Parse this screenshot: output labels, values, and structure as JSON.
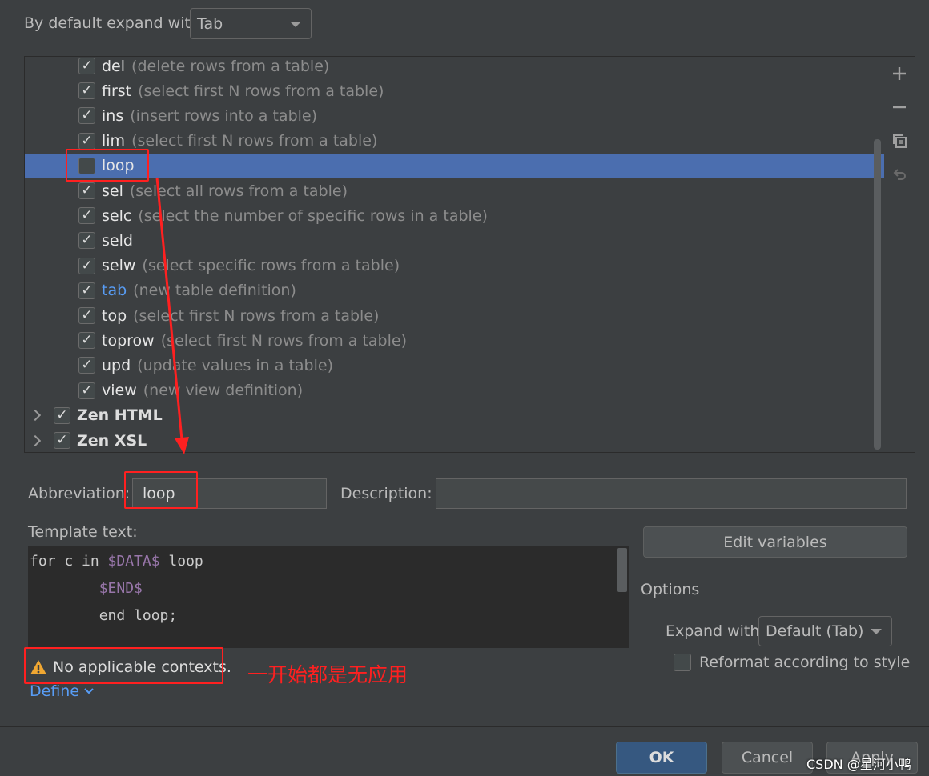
{
  "top": {
    "expand_label": "By default expand with",
    "expand_value": "Tab"
  },
  "tree": {
    "items": [
      {
        "abbr": "del",
        "desc": "(delete rows from a table)",
        "checked": true
      },
      {
        "abbr": "first",
        "desc": "(select first N rows from a table)",
        "checked": true
      },
      {
        "abbr": "ins",
        "desc": "(insert rows into a table)",
        "checked": true
      },
      {
        "abbr": "lim",
        "desc": "(select first N rows from a table)",
        "checked": true
      },
      {
        "abbr": "loop",
        "desc": "",
        "checked": false,
        "selected": true
      },
      {
        "abbr": "sel",
        "desc": "(select all rows from a table)",
        "checked": true
      },
      {
        "abbr": "selc",
        "desc": "(select the number of specific rows in a table)",
        "checked": true
      },
      {
        "abbr": "seld",
        "desc": "",
        "checked": true
      },
      {
        "abbr": "selw",
        "desc": "(select specific rows from a table)",
        "checked": true
      },
      {
        "abbr": "tab",
        "desc": "(new table definition)",
        "checked": true,
        "modified": true
      },
      {
        "abbr": "top",
        "desc": "(select first N rows from a table)",
        "checked": true
      },
      {
        "abbr": "toprow",
        "desc": "(select first N rows from a table)",
        "checked": true
      },
      {
        "abbr": "upd",
        "desc": "(update values in a table)",
        "checked": true
      },
      {
        "abbr": "view",
        "desc": "(new view definition)",
        "checked": true
      }
    ],
    "groups": [
      {
        "name": "Zen HTML",
        "checked": true
      },
      {
        "name": "Zen XSL",
        "checked": true
      }
    ]
  },
  "side_icons": [
    "add-icon",
    "remove-icon",
    "copy-icon",
    "undo-icon"
  ],
  "form": {
    "abbreviation_label": "Abbreviation:",
    "abbreviation_value": "loop",
    "description_label": "Description:",
    "description_value": "",
    "template_label": "Template text:",
    "template_lines": [
      {
        "pre": "for c in ",
        "var": "$DATA$",
        "post": " loop"
      },
      {
        "pre": "        ",
        "var": "$END$",
        "post": ""
      },
      {
        "pre": "        end loop;",
        "var": "",
        "post": ""
      }
    ],
    "edit_variables": "Edit variables",
    "options_title": "Options",
    "expand_with_label": "Expand with",
    "expand_with_value": "Default (Tab)",
    "reformat_label": "Reformat according to style",
    "reformat_checked": false,
    "warning": "No applicable contexts.",
    "define": "Define"
  },
  "annotation": "一开始都是无应用",
  "buttons": {
    "ok": "OK",
    "cancel": "Cancel",
    "apply": "Apply"
  },
  "watermark": "CSDN @星河小鸭",
  "colors": {
    "background": "#3c3f41",
    "selection": "#4b6eaf",
    "annotation_red": "#ff2020",
    "link_blue": "#589df6",
    "warning_yellow": "#f0a732"
  }
}
